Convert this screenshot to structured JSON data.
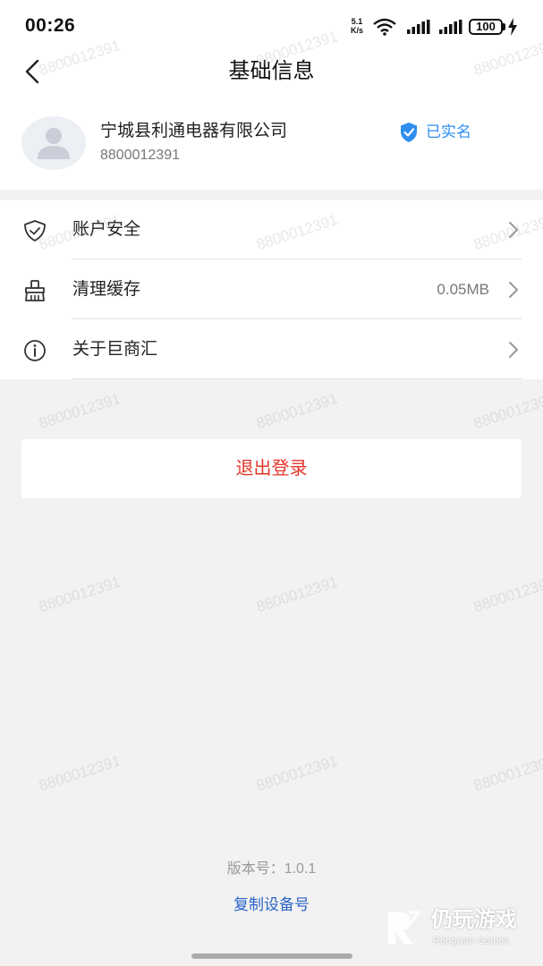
{
  "status_bar": {
    "time": "00:26",
    "net_speed_value": "5.1",
    "net_speed_unit": "K/s",
    "battery": "100"
  },
  "header": {
    "title": "基础信息"
  },
  "profile": {
    "company_name": "宁城县利通电器有限公司",
    "account_id": "8800012391",
    "verified_label": "已实名",
    "verified_color": "#2f8ef0"
  },
  "menu": {
    "items": [
      {
        "label": "账户安全",
        "value": "",
        "icon": "shield-check-icon"
      },
      {
        "label": "清理缓存",
        "value": "0.05MB",
        "icon": "broom-icon"
      },
      {
        "label": "关于巨商汇",
        "value": "",
        "icon": "info-icon"
      }
    ]
  },
  "logout": {
    "label": "退出登录",
    "color": "#e3342a"
  },
  "footer": {
    "version": "版本号：1.0.1",
    "copy_device": "复制设备号",
    "link_color": "#2b64c8"
  },
  "watermark": {
    "text": "8800012391"
  },
  "brand": {
    "name": "仍玩游戏",
    "sub": "Rengwan Games"
  }
}
